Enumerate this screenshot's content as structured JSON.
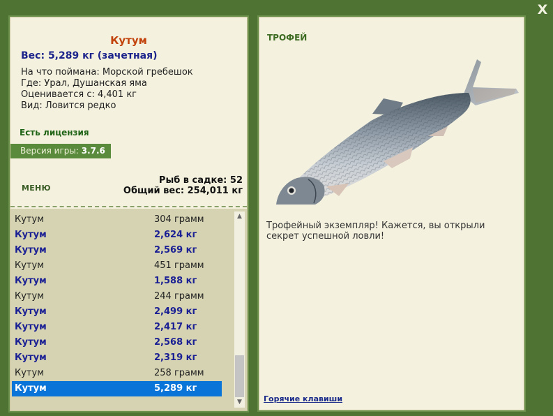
{
  "window": {
    "close_label": "X"
  },
  "fish": {
    "name": "Кутум",
    "weight": "Вес: 5,289 кг (зачетная)",
    "caught_on": "На что поймана: Морской гребешок",
    "where": "Где: Урал, Душанская яма",
    "rated_from": "Оценивается с: 4,401 кг",
    "species": "Вид: Ловится редко"
  },
  "license": "Есть лицензия",
  "version": {
    "label": "Версия игры: ",
    "value": "3.7.6"
  },
  "menu_label": "МЕНЮ",
  "stats": {
    "fish_in_keepnet": "Рыб в садке: 52",
    "total_weight": "Общий вес: 254,011 кг"
  },
  "catch_list": [
    {
      "name": "Кутум",
      "weight": "304 грамм",
      "zachet": false,
      "selected": false
    },
    {
      "name": "Кутум",
      "weight": "2,624 кг",
      "zachet": true,
      "selected": false
    },
    {
      "name": "Кутум",
      "weight": "2,569 кг",
      "zachet": true,
      "selected": false
    },
    {
      "name": "Кутум",
      "weight": "451 грамм",
      "zachet": false,
      "selected": false
    },
    {
      "name": "Кутум",
      "weight": "1,588 кг",
      "zachet": true,
      "selected": false
    },
    {
      "name": "Кутум",
      "weight": "244 грамм",
      "zachet": false,
      "selected": false
    },
    {
      "name": "Кутум",
      "weight": "2,499 кг",
      "zachet": true,
      "selected": false
    },
    {
      "name": "Кутум",
      "weight": "2,417 кг",
      "zachet": true,
      "selected": false
    },
    {
      "name": "Кутум",
      "weight": "2,568 кг",
      "zachet": true,
      "selected": false
    },
    {
      "name": "Кутум",
      "weight": "2,319 кг",
      "zachet": true,
      "selected": false
    },
    {
      "name": "Кутум",
      "weight": "258 грамм",
      "zachet": false,
      "selected": false
    },
    {
      "name": "Кутум",
      "weight": "5,289 кг",
      "zachet": true,
      "selected": true
    }
  ],
  "trophy": {
    "title": "ТРОФЕЙ",
    "message": "Трофейный экземпляр! Кажется, вы открыли секрет успешной ловли!"
  },
  "hotkeys_label": "Горячие клавиши",
  "colors": {
    "background": "#4e7332",
    "panel": "#f4f2df",
    "fish_name": "#c2430c",
    "weight_text": "#1d248b",
    "selection": "#0a74d9"
  }
}
